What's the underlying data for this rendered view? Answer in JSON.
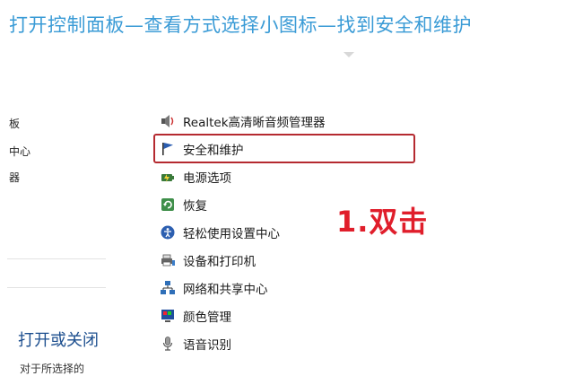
{
  "headline": "打开控制面板—查看方式选择小图标—找到安全和维护",
  "left_column": {
    "frag1": "板",
    "frag2": "中心",
    "frag3": "器",
    "heading": "打开或关闭",
    "sub": "对于所选择的"
  },
  "items": [
    {
      "label": "Realtek高清晰音频管理器",
      "icon": "speaker-icon"
    },
    {
      "label": "安全和维护",
      "icon": "flag-icon"
    },
    {
      "label": "电源选项",
      "icon": "power-icon"
    },
    {
      "label": "恢复",
      "icon": "recovery-icon"
    },
    {
      "label": "轻松使用设置中心",
      "icon": "ease-of-access-icon"
    },
    {
      "label": "设备和打印机",
      "icon": "printer-icon"
    },
    {
      "label": "网络和共享中心",
      "icon": "network-icon"
    },
    {
      "label": "颜色管理",
      "icon": "color-management-icon"
    },
    {
      "label": "语音识别",
      "icon": "microphone-icon"
    }
  ],
  "annotation": "1.双击",
  "colors": {
    "headline": "#3a9bd6",
    "highlight_border": "#b52a30",
    "annotation": "#e01e2b",
    "left_heading": "#1d4f8f"
  }
}
